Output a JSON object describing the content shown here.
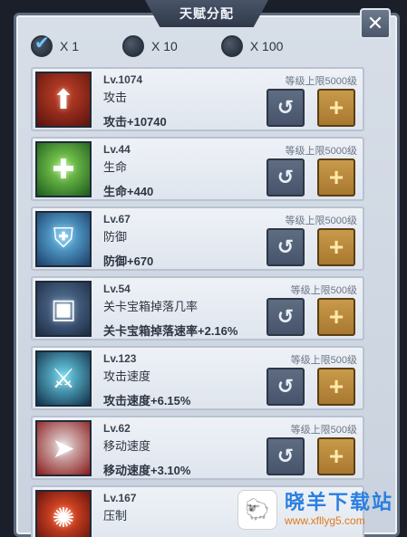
{
  "title": "天赋分配",
  "close_label": "✕",
  "multipliers": [
    {
      "label": "X 1",
      "selected": true
    },
    {
      "label": "X 10",
      "selected": false
    },
    {
      "label": "X 100",
      "selected": false
    }
  ],
  "talents": [
    {
      "level": "Lv.1074",
      "name": "攻击",
      "bonus": "攻击+10740",
      "limit": "等级上限5000级",
      "icon": "attack-icon"
    },
    {
      "level": "Lv.44",
      "name": "生命",
      "bonus": "生命+440",
      "limit": "等级上限5000级",
      "icon": "life-icon"
    },
    {
      "level": "Lv.67",
      "name": "防御",
      "bonus": "防御+670",
      "limit": "等级上限5000级",
      "icon": "shield-icon"
    },
    {
      "level": "Lv.54",
      "name": "关卡宝箱掉落几率",
      "bonus": "关卡宝箱掉落速率+2.16%",
      "limit": "等级上限500级",
      "icon": "treasure-chest-icon"
    },
    {
      "level": "Lv.123",
      "name": "攻击速度",
      "bonus": "攻击速度+6.15%",
      "limit": "等级上限500级",
      "icon": "attack-speed-icon"
    },
    {
      "level": "Lv.62",
      "name": "移动速度",
      "bonus": "移动速度+3.10%",
      "limit": "等级上限500级",
      "icon": "move-speed-icon"
    },
    {
      "level": "Lv.167",
      "name": "压制",
      "bonus": "",
      "limit": "",
      "icon": "suppress-icon"
    }
  ],
  "buttons": {
    "reset_symbol": "↺",
    "add_symbol": "+"
  },
  "watermark": {
    "name": "晓羊下载站",
    "url": "www.xfllyg5.com"
  }
}
